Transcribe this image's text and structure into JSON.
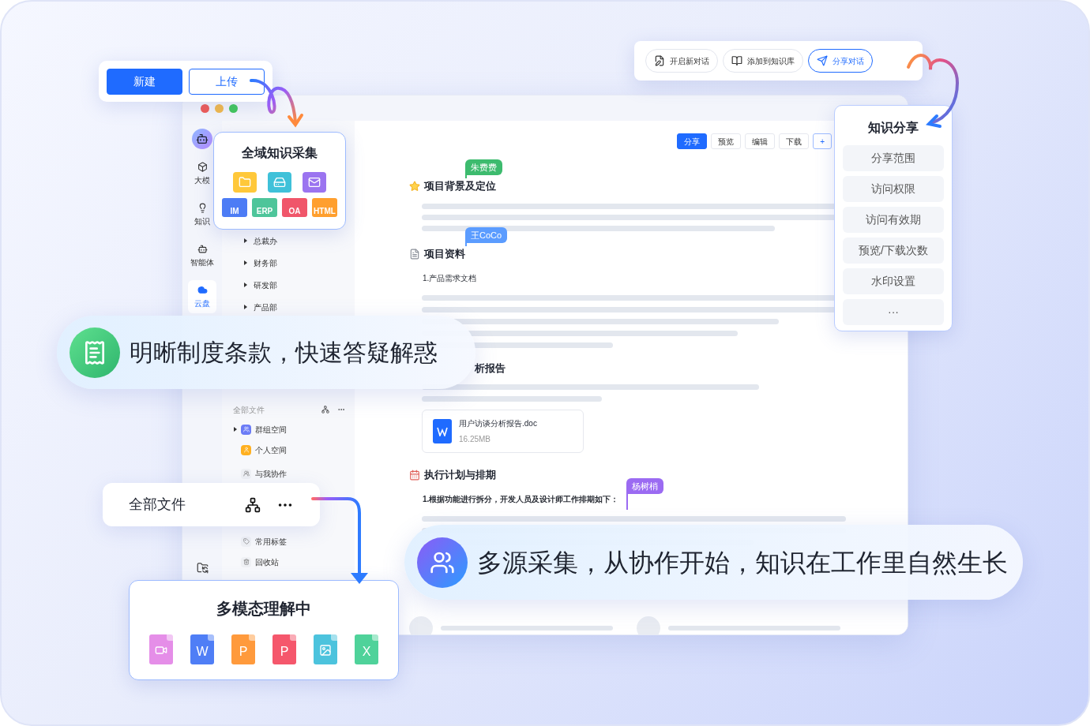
{
  "quick_actions": [
    {
      "label": "新建",
      "selected": true
    },
    {
      "label": "上传",
      "selected": false
    }
  ],
  "collect_card": {
    "title": "全域知识采集",
    "sources": [
      {
        "kind": "folder",
        "color": "#ffc83a"
      },
      {
        "kind": "drive",
        "color": "#3fc1d9"
      },
      {
        "kind": "mail",
        "color": "#9b74f0"
      }
    ],
    "file_badges": [
      {
        "label": "IM",
        "color": "#4d7cf5"
      },
      {
        "label": "ERP",
        "color": "#4ec59a"
      },
      {
        "label": "OA",
        "color": "#f0566a"
      },
      {
        "label": "HTML",
        "color": "#ff9f2e"
      }
    ]
  },
  "chat_toolbar": [
    {
      "kind": "new",
      "label": "开启新对话",
      "selected": false
    },
    {
      "kind": "book",
      "label": "添加到知识库",
      "selected": false
    },
    {
      "kind": "send",
      "label": "分享对话",
      "selected": true
    }
  ],
  "share_panel": {
    "title": "知识分享",
    "items": [
      "分享范围",
      "访问权限",
      "访问有效期",
      "预览/下载次数",
      "水印设置",
      "···"
    ]
  },
  "window": {
    "nav": [
      {
        "kind": "model",
        "label": "大模",
        "selected": false
      },
      {
        "kind": "knowledge",
        "label": "知识",
        "selected": false
      },
      {
        "kind": "agent",
        "label": "智能体",
        "selected": false
      },
      {
        "kind": "cloud",
        "label": "云盘",
        "selected": true
      }
    ],
    "departments": [
      "总裁办",
      "财务部",
      "研发部",
      "产品部"
    ],
    "files": {
      "header": "全部文件",
      "items": [
        {
          "kind": "group",
          "label": "群组空间",
          "expandable": true
        },
        {
          "kind": "personal",
          "label": "个人空间",
          "expandable": false
        },
        {
          "kind": "shared",
          "label": "与我协作",
          "expandable": false
        },
        {
          "kind": "tag",
          "label": "常用标签",
          "expandable": false
        },
        {
          "kind": "trash",
          "label": "回收站",
          "expandable": false
        }
      ]
    },
    "doc": {
      "actions": [
        {
          "label": "分享",
          "selected": true
        },
        {
          "label": "预览",
          "selected": false
        },
        {
          "label": "编辑",
          "selected": false
        },
        {
          "label": "下载",
          "selected": false
        },
        {
          "label": "+",
          "selected": false
        }
      ],
      "sections": [
        {
          "kind": "star",
          "title": "项目背景及定位",
          "cursor": {
            "name": "朱费费",
            "color": "#3dbb6e"
          }
        },
        {
          "kind": "file",
          "title": "项目资料",
          "cursor": {
            "name": "王CoCo",
            "color": "#5b9cff"
          },
          "paragraph": "1.产品需求文档"
        },
        {
          "kind": "partial",
          "title": "析报告",
          "attachment": {
            "name": "用户访谈分析报告.doc",
            "size": "16.25MB"
          }
        },
        {
          "kind": "calendar",
          "title": "执行计划与排期",
          "cursor": {
            "name": "杨树梢",
            "color": "#9b6bf2"
          },
          "paragraph": "1.根据功能进行拆分，开发人员及设计师工作排期如下："
        }
      ]
    }
  },
  "banners": [
    {
      "kind": "policy",
      "text": "明晰制度条款，快速答疑解惑"
    },
    {
      "kind": "collab",
      "text": "多源采集，从协作开始，知识在工作里自然生长"
    }
  ],
  "files_card": {
    "title": "全部文件"
  },
  "multimodal_card": {
    "title": "多模态理解中",
    "formats": [
      {
        "kind": "video",
        "color": "#e58ee8"
      },
      {
        "kind": "letter",
        "mark": "W",
        "color": "#4f7ef6"
      },
      {
        "kind": "letter",
        "mark": "P",
        "color": "#ff9a3c"
      },
      {
        "kind": "letter",
        "mark": "P",
        "color": "#f5576c"
      },
      {
        "kind": "image",
        "color": "#4cc3dd"
      },
      {
        "kind": "letter",
        "mark": "X",
        "color": "#4fd29a"
      }
    ]
  }
}
